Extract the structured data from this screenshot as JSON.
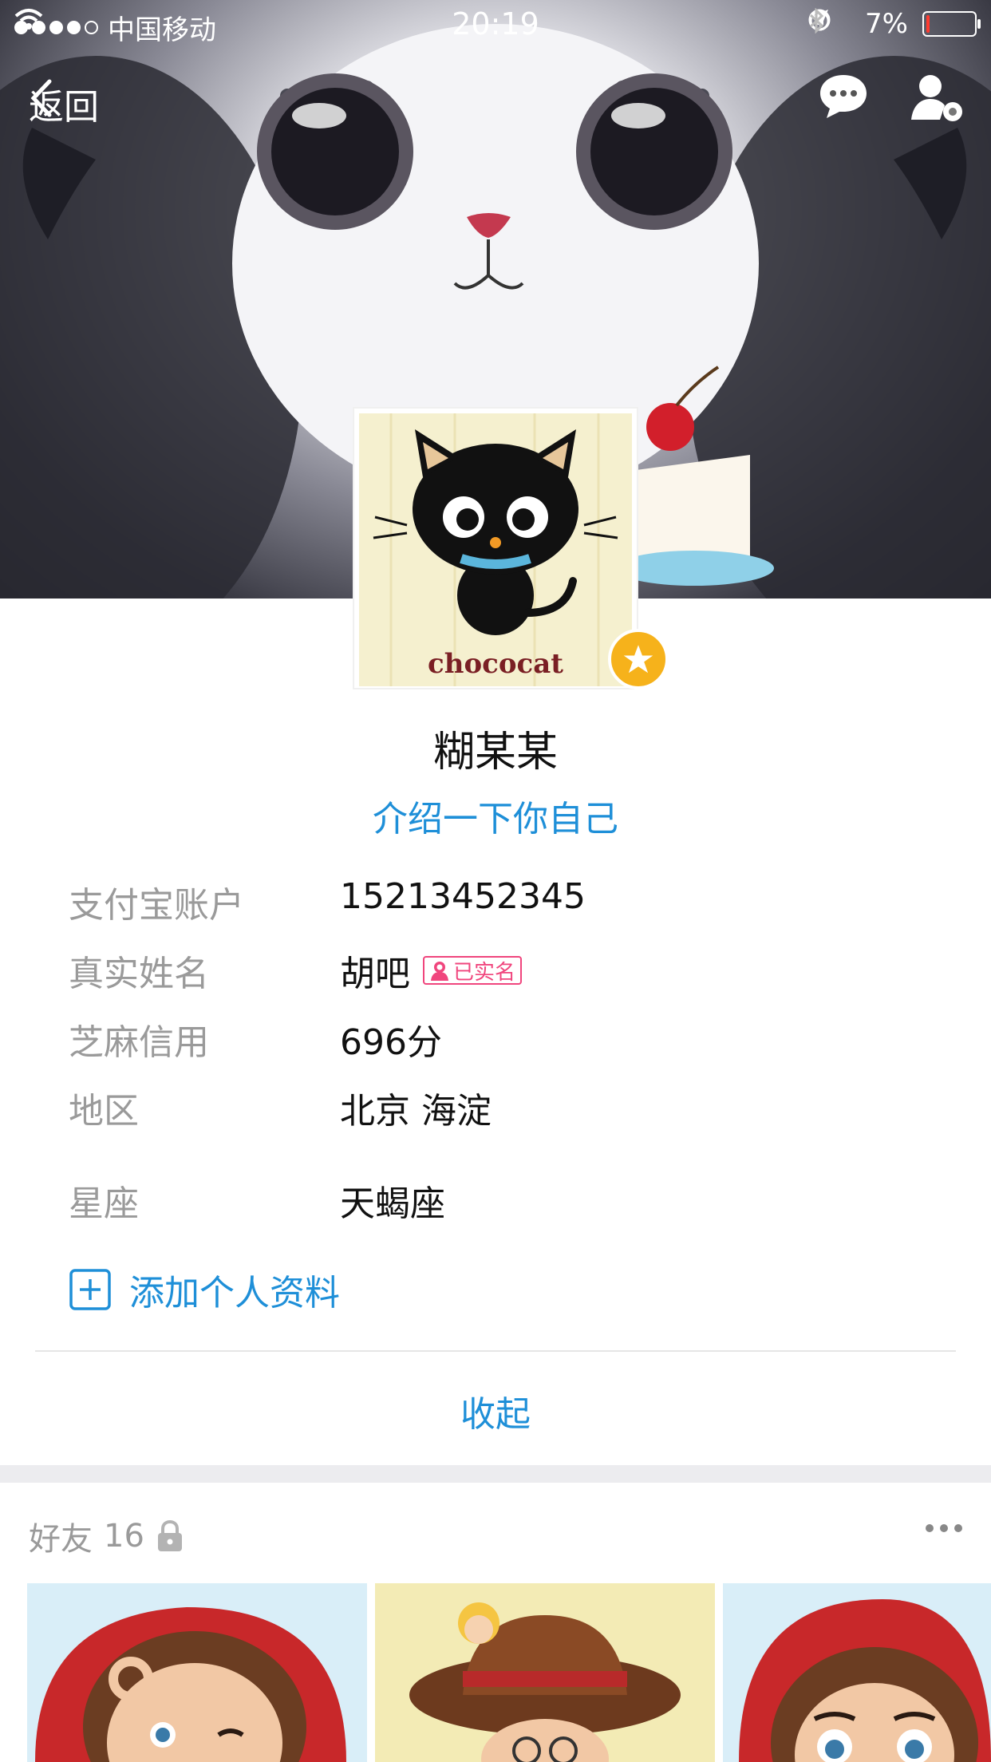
{
  "status_bar": {
    "carrier": "中国移动",
    "time": "20:19",
    "battery_percent": "7%",
    "battery_level": 0.07
  },
  "nav": {
    "back_label": "返回",
    "icons": [
      "chat-bubble-icon",
      "user-settings-icon"
    ]
  },
  "profile": {
    "nickname": "糊某某",
    "intro_prompt": "介绍一下你自己",
    "avatar_caption": "chococat"
  },
  "info": {
    "alipay_label": "支付宝账户",
    "alipay_value": "15213452345",
    "realname_label": "真实姓名",
    "realname_value": "胡吧",
    "verified_badge": "已实名",
    "sesame_label": "芝麻信用",
    "sesame_value": "696分",
    "region_label": "地区",
    "region_value": "北京 海淀",
    "zodiac_label": "星座",
    "zodiac_value": "天蝎座"
  },
  "actions": {
    "add_profile": "添加个人资料",
    "collapse": "收起"
  },
  "friends": {
    "label": "好友",
    "count": "16"
  },
  "colors": {
    "accent": "#1e8fd8",
    "label_gray": "#9a9a9a",
    "verified_pink": "#f0457d",
    "badge_gold": "#f6b21b"
  }
}
